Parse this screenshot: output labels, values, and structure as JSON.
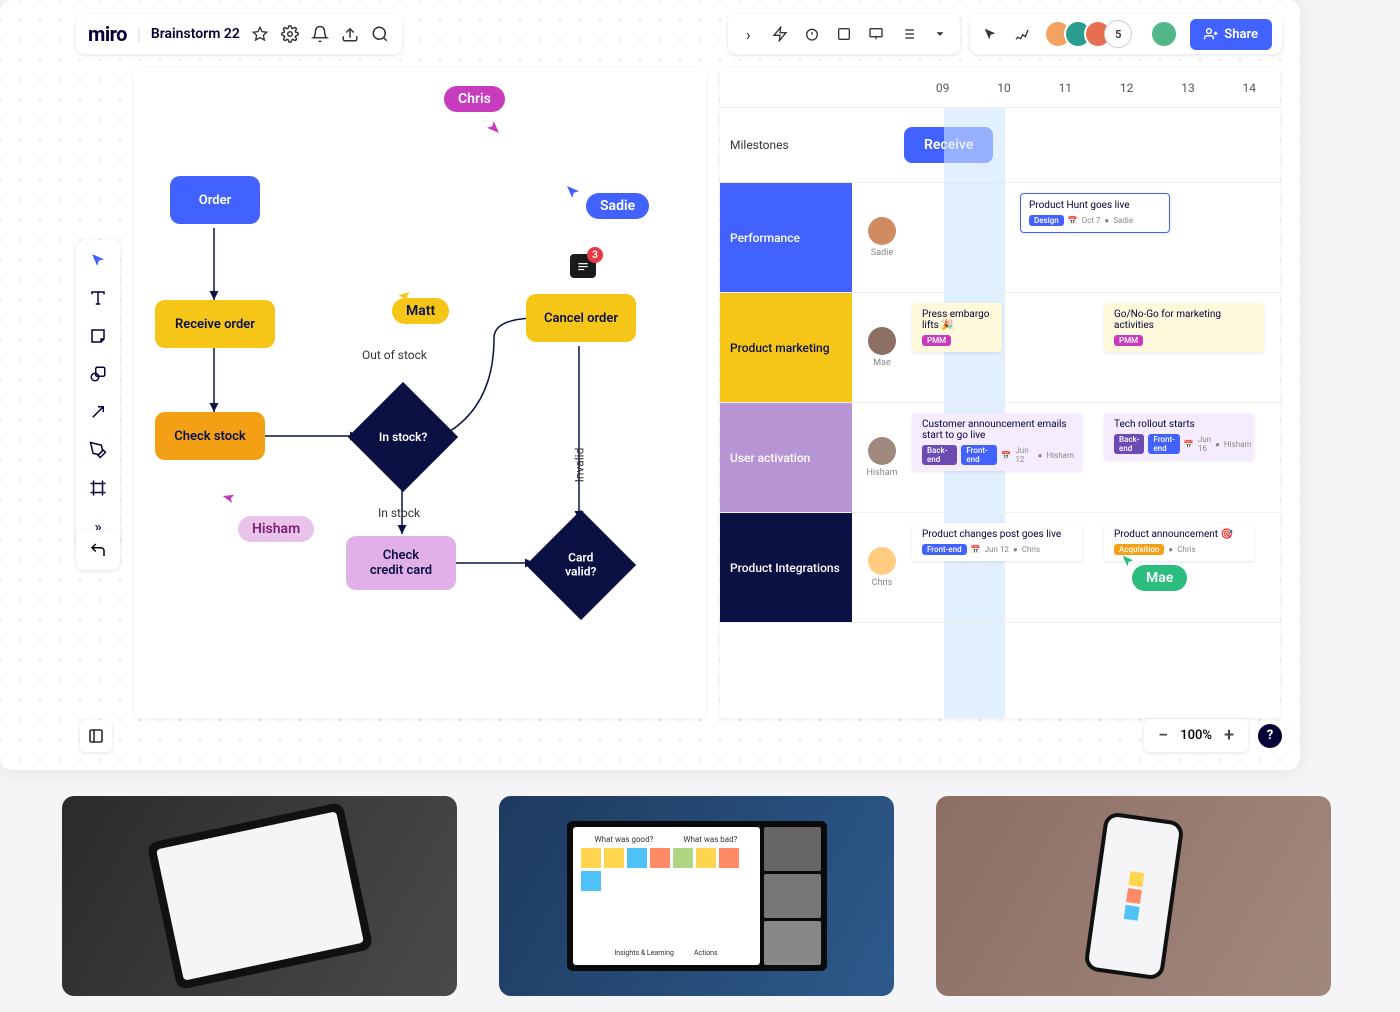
{
  "header": {
    "logo": "miro",
    "board": "Brainstorm 22"
  },
  "collab": {
    "count": "5",
    "share": "Share"
  },
  "flow": {
    "order": "Order",
    "receive": "Receive order",
    "check_stock": "Check stock",
    "in_stock_q": "In stock?",
    "cancel": "Cancel order",
    "check_cc": "Check\ncredit card",
    "card_valid": "Card\nvalid?",
    "out_of_stock": "Out of stock",
    "in_stock": "In stock",
    "invalid": "Invalid"
  },
  "cursors": {
    "chris": "Chris",
    "sadie": "Sadie",
    "matt": "Matt",
    "hisham": "Hisham",
    "mae": "Mae"
  },
  "comment": {
    "count": "3"
  },
  "timeline": {
    "dates": [
      "09",
      "10",
      "11",
      "12",
      "13",
      "14"
    ],
    "milestones_label": "Milestones",
    "milestone_pill": "Receive",
    "rows": [
      {
        "label": "Performance",
        "person": "Sadie",
        "color": "#4262ff"
      },
      {
        "label": "Product marketing",
        "person": "Mae",
        "color": "#f5c518"
      },
      {
        "label": "User activation",
        "person": "Hisham",
        "color": "#b794d4"
      },
      {
        "label": "Product Integrations",
        "person": "Chris",
        "color": "#0b1142"
      }
    ],
    "cards": {
      "ph": "Product Hunt goes live",
      "ph_tag": "Design",
      "ph_date": "Oct 7",
      "ph_owner": "Sadie",
      "embargo": "Press embargo lifts 🎉",
      "embargo_tag": "PMM",
      "gonogo": "Go/No-Go for marketing activities",
      "gonogo_tag": "PMM",
      "announce": "Customer announcement emails start to go live",
      "announce_tag1": "Back-end",
      "announce_tag2": "Front-end",
      "announce_date": "Jun 12",
      "announce_owner": "Hisham",
      "tech": "Tech rollout starts",
      "tech_tag1": "Back-end",
      "tech_tag2": "Front-end",
      "tech_date": "Jun 16",
      "tech_owner": "Hisham",
      "pchanges": "Product changes post goes live",
      "pchanges_tag": "Front-end",
      "pchanges_date": "Jun 12",
      "pchanges_owner": "Chris",
      "pann": "Product announcement 🎯",
      "pann_tag": "Acquisition",
      "pann_owner": "Chris"
    }
  },
  "zoom": {
    "level": "100%"
  },
  "photo_captions": {
    "a": "What was good?",
    "b": "What was bad?",
    "c": "Insights & Learning",
    "d": "Actions"
  }
}
